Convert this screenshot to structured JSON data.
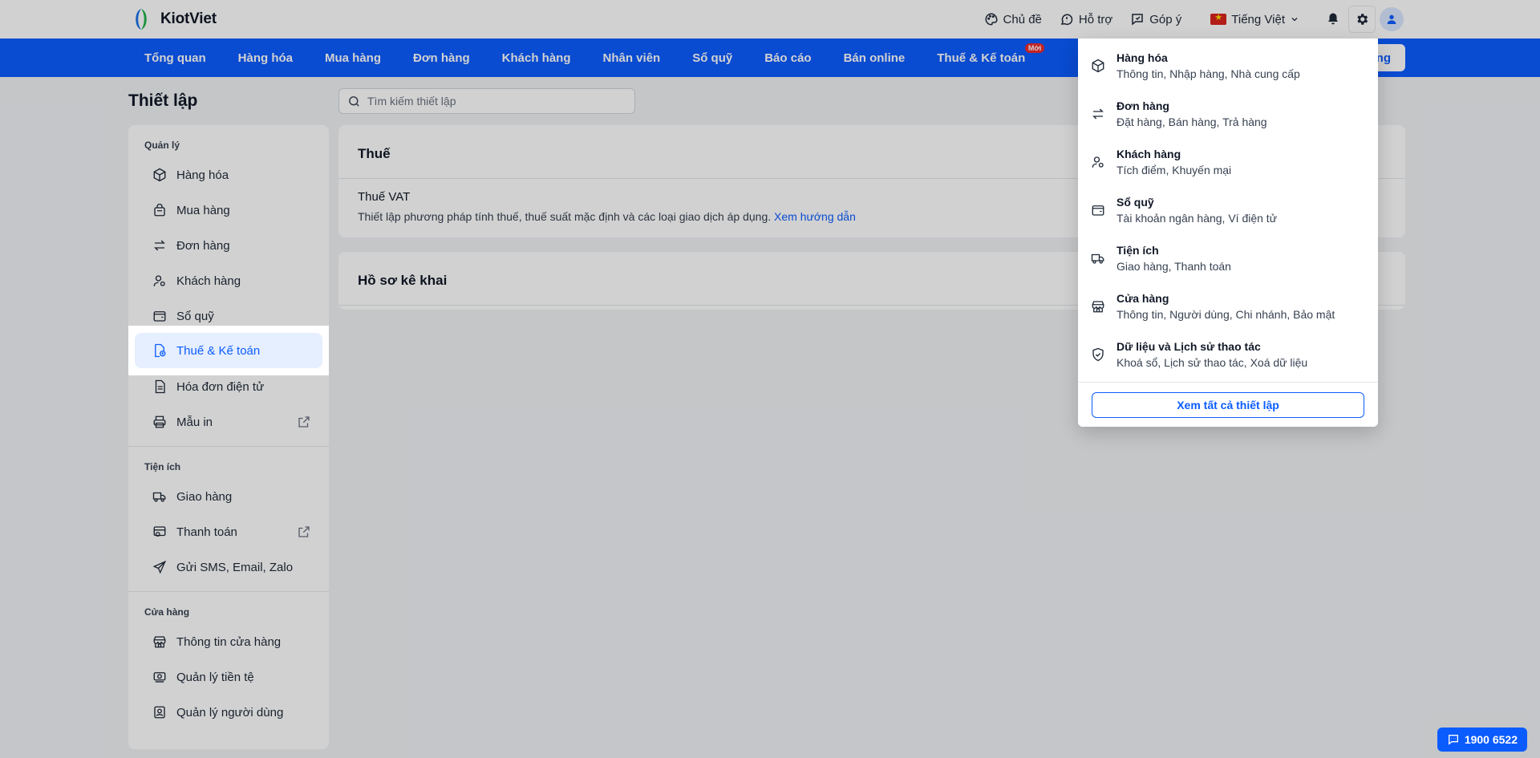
{
  "brand": {
    "name": "KiotViet"
  },
  "topbar": {
    "theme": "Chủ đề",
    "support": "Hỗ trợ",
    "feedback": "Góp ý",
    "language": "Tiếng Việt"
  },
  "nav": {
    "items": [
      "Tổng quan",
      "Hàng hóa",
      "Mua hàng",
      "Đơn hàng",
      "Khách hàng",
      "Nhân viên",
      "Sổ quỹ",
      "Báo cáo",
      "Bán online",
      "Thuế & Kế toán"
    ],
    "new_badge": "Mới",
    "cta": "ng"
  },
  "page": {
    "title": "Thiết lập",
    "search_placeholder": "Tìm kiếm thiết lập"
  },
  "sidebar": {
    "sections": [
      {
        "label": "Quản lý",
        "items": [
          {
            "label": "Hàng hóa",
            "icon": "box-icon"
          },
          {
            "label": "Mua hàng",
            "icon": "bag-icon"
          },
          {
            "label": "Đơn hàng",
            "icon": "swap-icon"
          },
          {
            "label": "Khách hàng",
            "icon": "user-settings-icon"
          },
          {
            "label": "Sổ quỹ",
            "icon": "wallet-icon"
          },
          {
            "label": "Thuế & Kế toán",
            "icon": "tax-doc-icon",
            "active": true
          },
          {
            "label": "Hóa đơn điện tử",
            "icon": "document-icon"
          },
          {
            "label": "Mẫu in",
            "icon": "printer-icon",
            "external": true
          }
        ]
      },
      {
        "label": "Tiện ích",
        "items": [
          {
            "label": "Giao hàng",
            "icon": "truck-icon"
          },
          {
            "label": "Thanh toán",
            "icon": "payment-icon",
            "external": true
          },
          {
            "label": "Gửi SMS, Email, Zalo",
            "icon": "send-icon"
          }
        ]
      },
      {
        "label": "Cửa hàng",
        "items": [
          {
            "label": "Thông tin cửa hàng",
            "icon": "store-icon"
          },
          {
            "label": "Quản lý tiền tệ",
            "icon": "money-icon"
          },
          {
            "label": "Quản lý người dùng",
            "icon": "user-badge-icon"
          }
        ]
      }
    ]
  },
  "main": {
    "tax_card": {
      "title": "Thuế",
      "row_title": "Thuế VAT",
      "row_desc": "Thiết lập phương pháp tính thuế, thuế suất mặc định và các loại giao dịch áp dụng.",
      "link": "Xem hướng dẫn"
    },
    "declaration_card": {
      "title": "Hồ sơ kê khai"
    }
  },
  "dropdown": {
    "items": [
      {
        "title": "Hàng hóa",
        "sub": "Thông tin, Nhập hàng, Nhà cung cấp",
        "icon": "box-icon"
      },
      {
        "title": "Đơn hàng",
        "sub": "Đặt hàng, Bán hàng, Trả hàng",
        "icon": "swap-icon"
      },
      {
        "title": "Khách hàng",
        "sub": "Tích điểm, Khuyến mại",
        "icon": "user-settings-icon"
      },
      {
        "title": "Sổ quỹ",
        "sub": "Tài khoản ngân hàng, Ví điện tử",
        "icon": "wallet-icon"
      },
      {
        "title": "Tiện ích",
        "sub": "Giao hàng, Thanh toán",
        "icon": "truck-icon"
      },
      {
        "title": "Cửa hàng",
        "sub": "Thông tin, Người dùng, Chi nhánh, Bảo mật",
        "icon": "store-icon"
      },
      {
        "title": "Dữ liệu và Lịch sử thao tác",
        "sub": "Khoá sổ, Lịch sử thao tác, Xoá dữ liệu",
        "icon": "shield-check-icon"
      }
    ],
    "footer_button": "Xem tất cả thiết lập"
  },
  "hotline": "1900 6522",
  "colors": {
    "primary": "#0b5cff",
    "badge": "#ef2b2b"
  }
}
